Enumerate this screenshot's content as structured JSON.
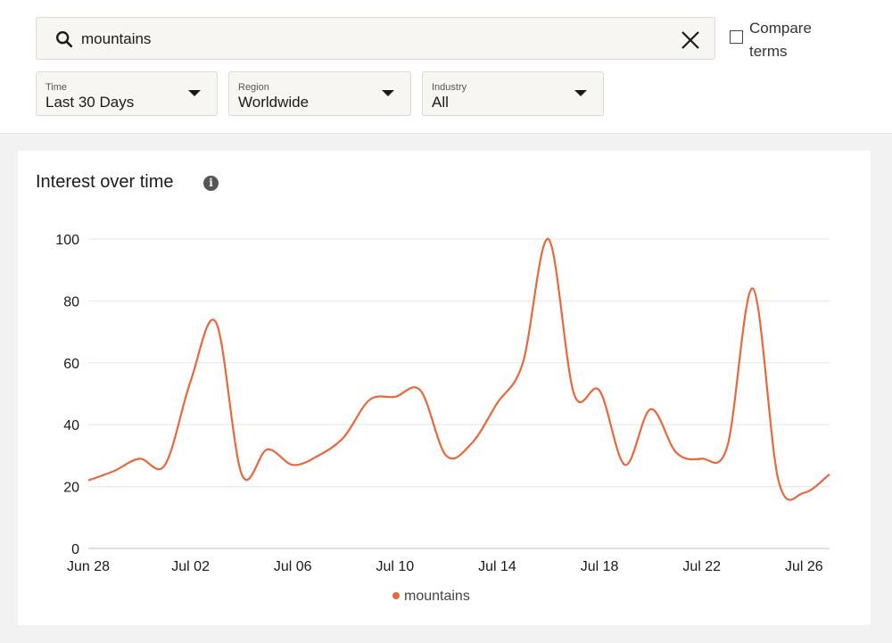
{
  "search": {
    "query": "mountains",
    "clear_icon": "close-icon",
    "search_icon": "search-icon"
  },
  "compare": {
    "label": "Compare terms",
    "checked": false
  },
  "filters": {
    "time": {
      "label": "Time",
      "value": "Last 30 Days"
    },
    "region": {
      "label": "Region",
      "value": "Worldwide"
    },
    "industry": {
      "label": "Industry",
      "value": "All"
    }
  },
  "card": {
    "title": "Interest over time",
    "info_icon": "info-icon"
  },
  "colors": {
    "series": "#e8673c",
    "grid": "#e5e5e5"
  },
  "chart_data": {
    "type": "line",
    "x": [
      "Jun 28",
      "Jun 29",
      "Jun 30",
      "Jul 01",
      "Jul 02",
      "Jul 03",
      "Jul 04",
      "Jul 05",
      "Jul 06",
      "Jul 07",
      "Jul 08",
      "Jul 09",
      "Jul 10",
      "Jul 11",
      "Jul 12",
      "Jul 13",
      "Jul 14",
      "Jul 15",
      "Jul 16",
      "Jul 17",
      "Jul 18",
      "Jul 19",
      "Jul 20",
      "Jul 21",
      "Jul 22",
      "Jul 23",
      "Jul 24",
      "Jul 25",
      "Jul 26",
      "Jul 27"
    ],
    "x_ticks": [
      "Jun 28",
      "Jul 02",
      "Jul 06",
      "Jul 10",
      "Jul 14",
      "Jul 18",
      "Jul 22",
      "Jul 26"
    ],
    "series": [
      {
        "name": "mountains",
        "values": [
          22,
          25,
          29,
          27,
          54,
          73,
          24,
          32,
          27,
          30,
          36,
          48,
          49,
          51,
          30,
          34,
          47,
          60,
          100,
          50,
          51,
          27,
          45,
          31,
          29,
          33,
          84,
          22,
          18,
          24
        ]
      }
    ],
    "ylim": [
      0,
      100
    ],
    "y_ticks": [
      0,
      20,
      40,
      60,
      80,
      100
    ],
    "grid": true,
    "legend_position": "bottom"
  }
}
